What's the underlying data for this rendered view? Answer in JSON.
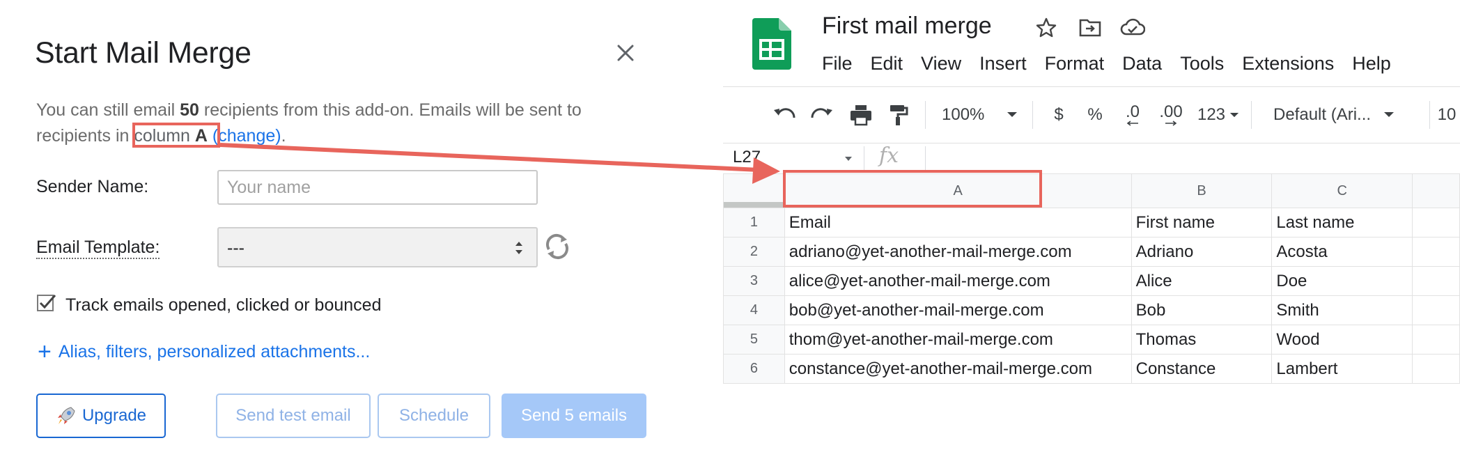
{
  "dialog": {
    "title": "Start Mail Merge",
    "info": {
      "pre": "You can still email ",
      "count": "50",
      "mid": " recipients from this add-on. Emails will be sent to recipients in ",
      "column_word": "column ",
      "column_letter": "A",
      "space": " ",
      "change_link": "(change)",
      "end": "."
    },
    "sender_label": "Sender Name:",
    "sender_placeholder": "Your name",
    "sender_value": "",
    "template_label": "Email Template:",
    "template_value": "---",
    "track_label": "Track emails opened, clicked or bounced",
    "track_checked": true,
    "alias_plus": "+",
    "alias_link": "Alias, filters, personalized attachments...",
    "buttons": {
      "upgrade": "Upgrade",
      "send_test": "Send test email",
      "schedule": "Schedule",
      "send": "Send 5 emails"
    }
  },
  "sheets": {
    "title": "First mail merge",
    "menu": [
      "File",
      "Edit",
      "View",
      "Insert",
      "Format",
      "Data",
      "Tools",
      "Extensions",
      "Help"
    ],
    "toolbar": {
      "zoom": "100%",
      "currency": "$",
      "percent": "%",
      "dec_decrease": ".0",
      "dec_increase": ".00",
      "number_format": "123",
      "font": "Default (Ari...",
      "font_size": "10"
    },
    "name_box": "L27",
    "fx": "fx",
    "columns": [
      "A",
      "B",
      "C"
    ],
    "rows": [
      {
        "num": "1",
        "cells": [
          "Email",
          "First name",
          "Last name"
        ]
      },
      {
        "num": "2",
        "cells": [
          "adriano@yet-another-mail-merge.com",
          "Adriano",
          "Acosta"
        ]
      },
      {
        "num": "3",
        "cells": [
          "alice@yet-another-mail-merge.com",
          "Alice",
          "Doe"
        ]
      },
      {
        "num": "4",
        "cells": [
          "bob@yet-another-mail-merge.com",
          "Bob",
          "Smith"
        ]
      },
      {
        "num": "5",
        "cells": [
          "thom@yet-another-mail-merge.com",
          "Thomas",
          "Wood"
        ]
      },
      {
        "num": "6",
        "cells": [
          "constance@yet-another-mail-merge.com",
          "Constance",
          "Lambert"
        ]
      }
    ]
  },
  "colors": {
    "accent": "#1a73e8",
    "highlight": "#e8655c",
    "sheets_green": "#0f9d58",
    "send_disabled": "#a5c8f8"
  }
}
